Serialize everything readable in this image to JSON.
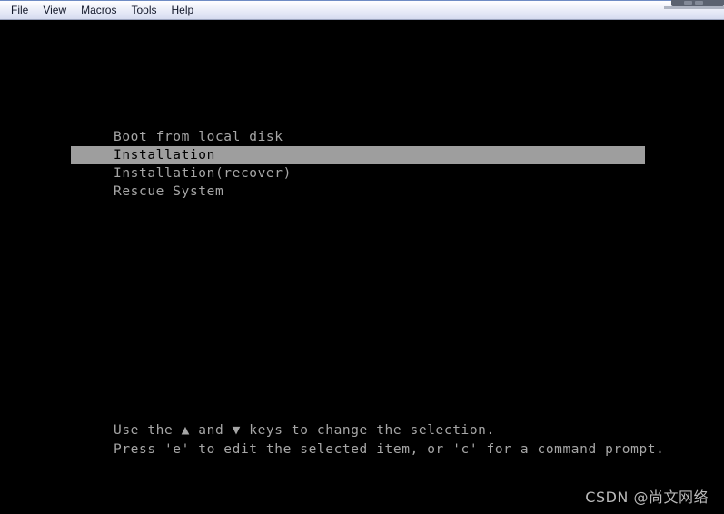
{
  "window": {
    "background_color": "#000000",
    "titlebar_fragment": {
      "present": true,
      "color": "#5b6270"
    }
  },
  "menubar": {
    "background_color": "#e4e8f6",
    "text_color": "#14192b",
    "items": [
      {
        "label": "File"
      },
      {
        "label": "View"
      },
      {
        "label": "Macros"
      },
      {
        "label": "Tools"
      },
      {
        "label": "Help"
      }
    ]
  },
  "boot_menu": {
    "text_color": "#a6a6a6",
    "highlight_background": "#9e9e9e",
    "highlight_text_color": "#000000",
    "selected_index": 1,
    "entries": [
      {
        "label": "Boot from local disk",
        "selected": false
      },
      {
        "label": "Installation",
        "selected": true
      },
      {
        "label": "Installation(recover)",
        "selected": false
      },
      {
        "label": "Rescue System",
        "selected": false
      }
    ]
  },
  "help": {
    "lines": [
      "Use the ▲ and ▼ keys to change the selection.",
      "Press 'e' to edit the selected item, or 'c' for a command prompt."
    ]
  },
  "watermark": {
    "text": "CSDN @尚文网络",
    "color": "#b9b9b9"
  }
}
